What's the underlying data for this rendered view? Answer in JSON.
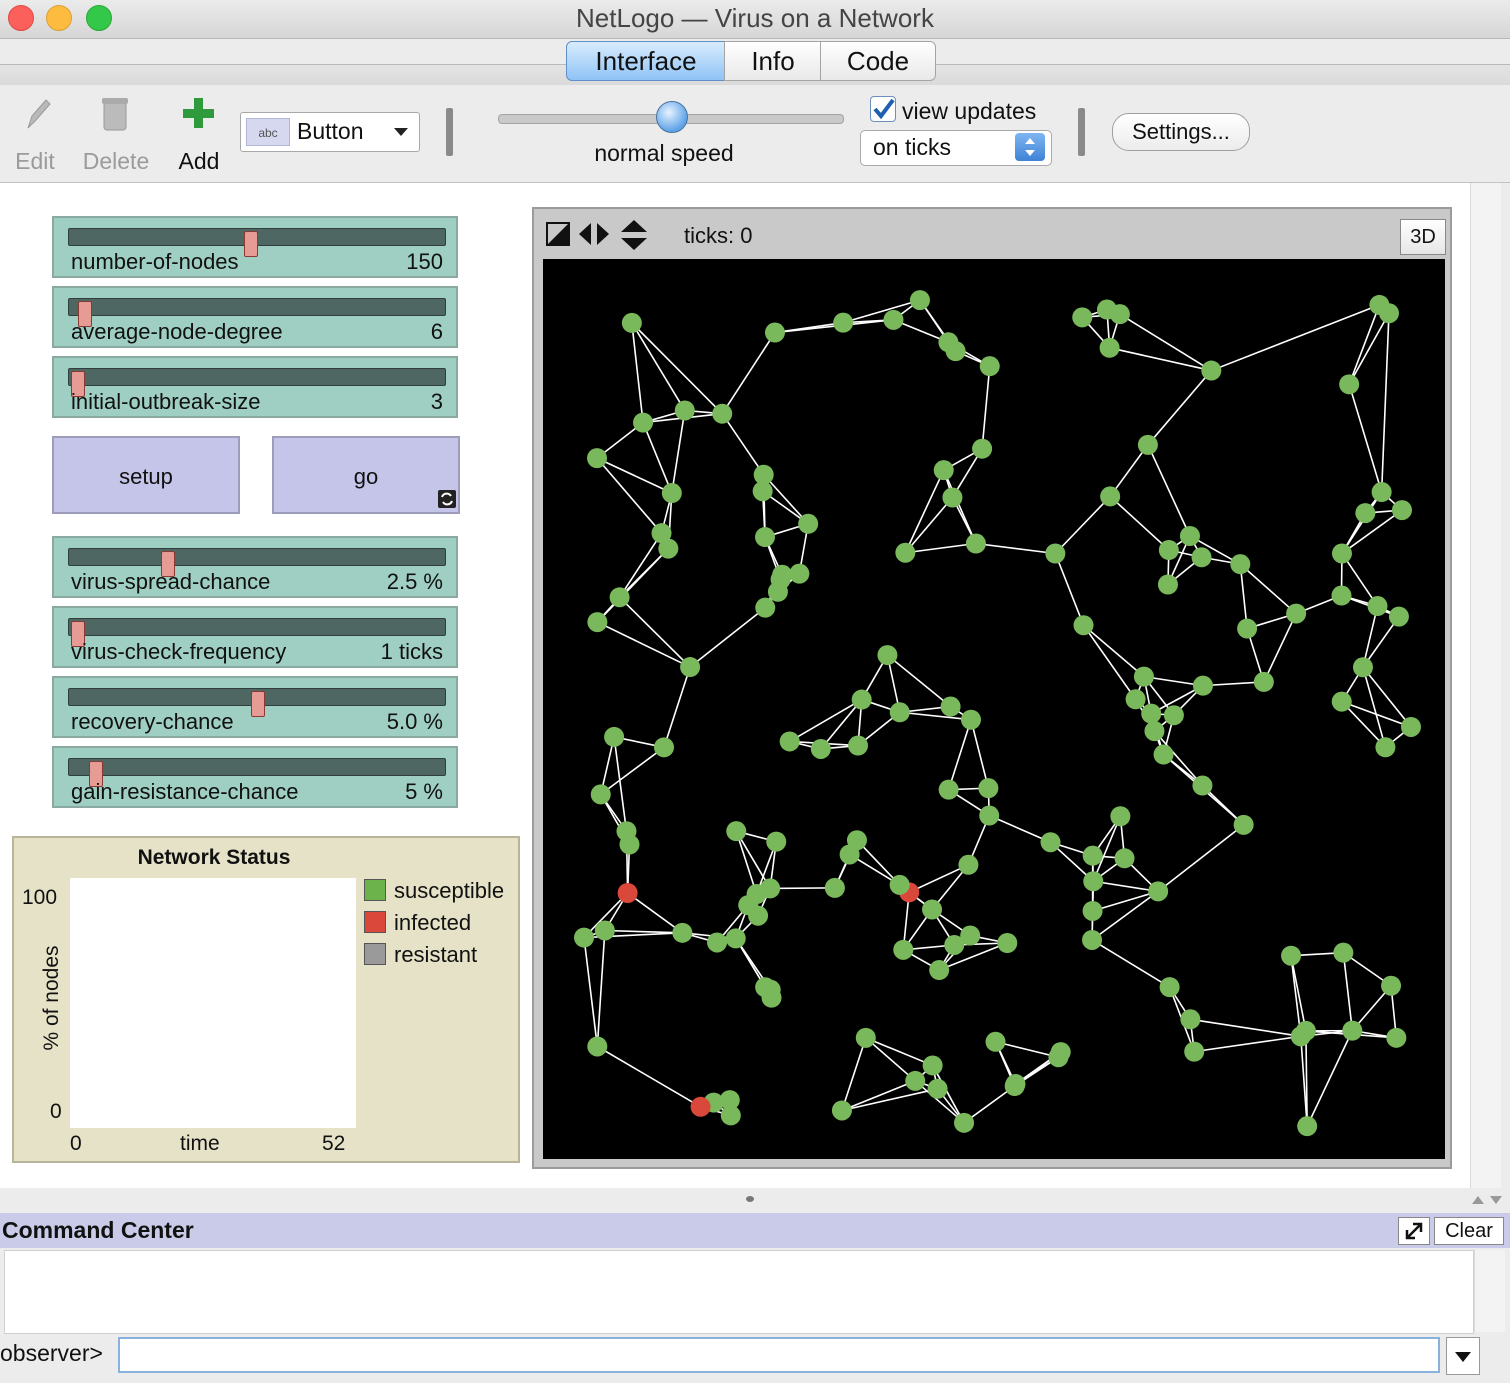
{
  "window": {
    "title": "NetLogo — Virus on a Network"
  },
  "tabs": [
    {
      "label": "Interface"
    },
    {
      "label": "Info"
    },
    {
      "label": "Code"
    }
  ],
  "toolbar": {
    "edit_label": "Edit",
    "delete_label": "Delete",
    "add_label": "Add",
    "widget_type": "Button",
    "widget_icon_text": "abc",
    "speed_label": "normal speed",
    "speed_value": 0.5,
    "view_updates_label": "view updates",
    "view_updates_checked": true,
    "update_mode": "on ticks",
    "settings_label": "Settings..."
  },
  "sliders": [
    {
      "name": "number-of-nodes",
      "value": "150",
      "fraction": 0.48
    },
    {
      "name": "average-node-degree",
      "value": "6",
      "fraction": 0.02
    },
    {
      "name": "initial-outbreak-size",
      "value": "3",
      "fraction": 0.0
    },
    {
      "name": "virus-spread-chance",
      "value": "2.5 %",
      "fraction": 0.25
    },
    {
      "name": "virus-check-frequency",
      "value": "1 ticks",
      "fraction": 0.0
    },
    {
      "name": "recovery-chance",
      "value": "5.0 %",
      "fraction": 0.5
    },
    {
      "name": "gain-resistance-chance",
      "value": "5 %",
      "fraction": 0.05
    }
  ],
  "buttons": {
    "setup": "setup",
    "go": "go"
  },
  "plot": {
    "title": "Network Status",
    "ylabel": "% of nodes",
    "xlabel": "time",
    "ymax": "100",
    "ymin": "0",
    "xmin": "0",
    "xmax": "52",
    "legend": [
      {
        "label": "susceptible",
        "color": "#6bb34a"
      },
      {
        "label": "infected",
        "color": "#d9483b"
      },
      {
        "label": "resistant",
        "color": "#9a9a9a"
      }
    ]
  },
  "view": {
    "ticks_label": "ticks: 0",
    "btn_3d": "3D",
    "node_color": "#79b95b",
    "infected_color": "#d9483b"
  },
  "command_center": {
    "title": "Command Center",
    "clear_label": "Clear",
    "prompt": "observer>",
    "input_value": ""
  },
  "colors": {
    "slider_bg": "#9fcfc2",
    "button_bg": "#c5c5ea",
    "plot_bg": "#e6e2c7",
    "tab_active": "#8fc3f6"
  }
}
